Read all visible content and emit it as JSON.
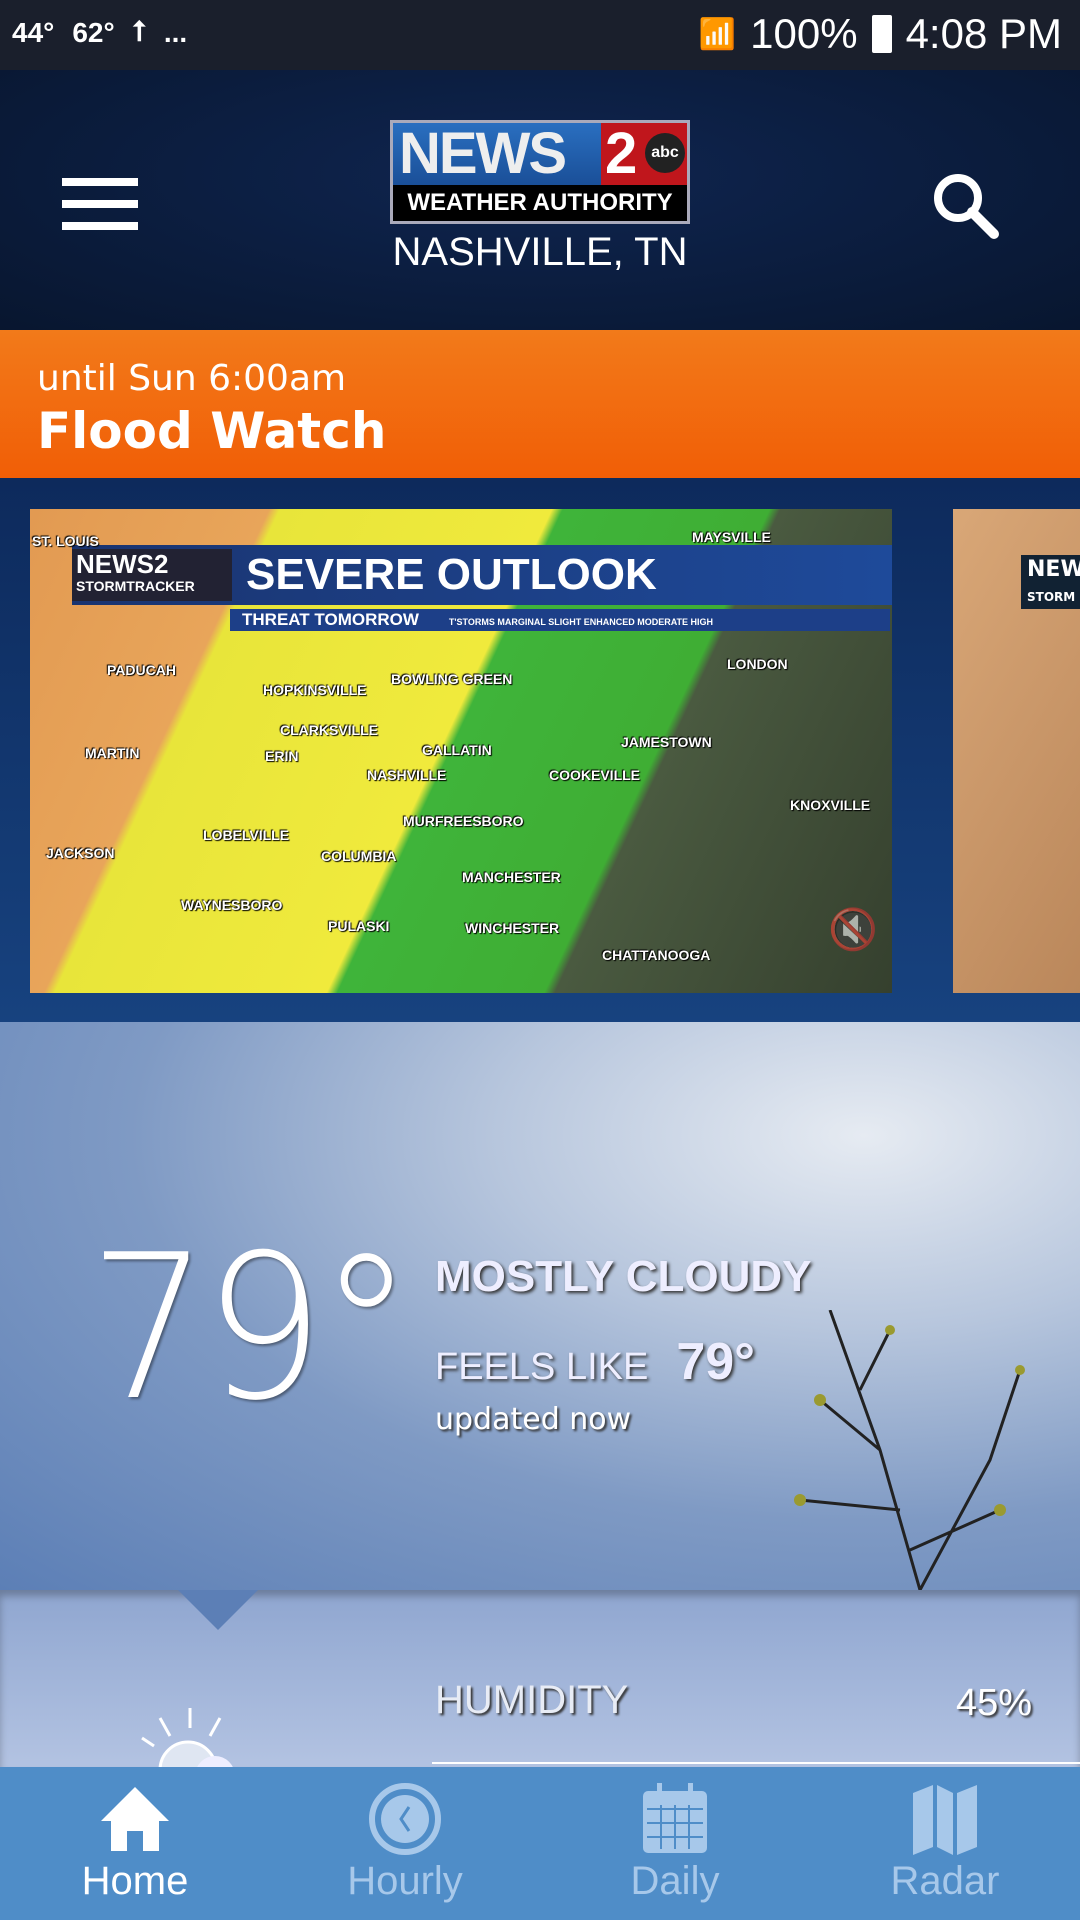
{
  "status_bar": {
    "temp_low": "44°",
    "temp_high": "62°",
    "more": "...",
    "battery": "100%",
    "time": "4:08 PM"
  },
  "header": {
    "logo_news": "NEWS",
    "logo_number": "2",
    "logo_network": "abc",
    "logo_tagline": "WEATHER AUTHORITY",
    "location": "NASHVILLE, TN"
  },
  "alert": {
    "subtitle": "until Sun 6:00am",
    "title": "Flood Watch",
    "color": "#f26a0f"
  },
  "video": {
    "logo": "NEWS2",
    "logo_sub": "STORMTRACKER",
    "title": "SEVERE OUTLOOK",
    "threat_label": "THREAT TOMORROW",
    "legend": "T'STORMS  MARGINAL  SLIGHT  ENHANCED  MODERATE  HIGH",
    "cities": [
      "ST. LOUIS",
      "MAYSVILLE",
      "PADUCAH",
      "HOPKINSVILLE",
      "BOWLING GREEN",
      "LONDON",
      "CLARKSVILLE",
      "GALLATIN",
      "JAMESTOWN",
      "MARTIN",
      "ERIN",
      "NASHVILLE",
      "COOKEVILLE",
      "KNOXVILLE",
      "MURFREESBORO",
      "LOBELVILLE",
      "JACKSON",
      "COLUMBIA",
      "MANCHESTER",
      "WAYNESBORO",
      "PULASKI",
      "WINCHESTER",
      "CHATTANOOGA"
    ],
    "next_logo": "NEWS",
    "next_logo_sub": "STORM"
  },
  "current": {
    "temp": "79°",
    "condition": "MOSTLY CLOUDY",
    "feels_like_label": "FEELS LIKE",
    "feels_like": "79°",
    "updated": "updated now"
  },
  "details": {
    "humidity_label": "HUMIDITY",
    "humidity_value": "45%"
  },
  "nav": {
    "items": [
      {
        "label": "Home",
        "icon": "home-icon",
        "active": true
      },
      {
        "label": "Hourly",
        "icon": "clock-icon"
      },
      {
        "label": "Daily",
        "icon": "calendar-icon"
      },
      {
        "label": "Radar",
        "icon": "map-icon"
      }
    ]
  }
}
